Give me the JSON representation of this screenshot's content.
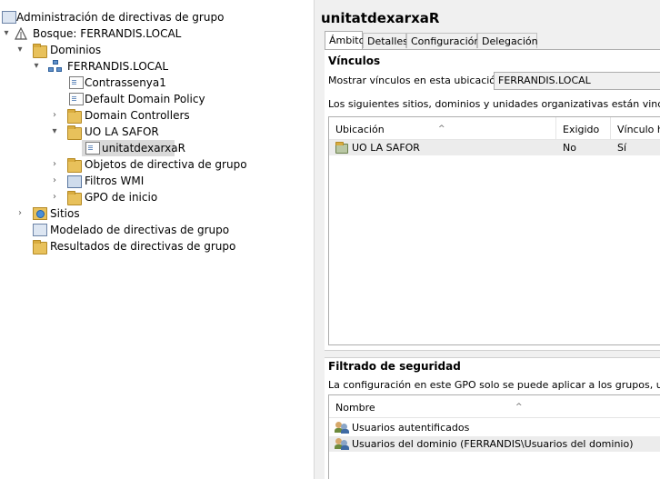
{
  "tree": {
    "root": "Administración de directivas de grupo",
    "forest": "Bosque: FERRANDIS.LOCAL",
    "domains": "Dominios",
    "domain": "FERRANDIS.LOCAL",
    "contrassenya": "Contrassenya1",
    "default_policy": "Default Domain Policy",
    "domain_controllers": "Domain Controllers",
    "ou": "UO LA SAFOR",
    "ou_gpo": "unitatdexarxaR",
    "gpo_objects": "Objetos de directiva de grupo",
    "wmi": "Filtros WMI",
    "starter": "GPO de inicio",
    "sites": "Sitios",
    "modeling": "Modelado de directivas de grupo",
    "results": "Resultados de directivas de grupo"
  },
  "detail": {
    "title": "unitatdexarxaR",
    "tabs": [
      "Ámbito",
      "Detalles",
      "Configuración",
      "Delegación"
    ],
    "links_section": "Vínculos",
    "show_links_label": "Mostrar vínculos en esta ubicación:",
    "show_links_value": "FERRANDIS.LOCAL",
    "links_description": "Los siguientes sitios, dominios y unidades organizativas están vinculados a este GPO:",
    "links_columns": [
      "Ubicación",
      "Exigido",
      "Vínculo habilitado"
    ],
    "links_rows": [
      {
        "location": "UO LA SAFOR",
        "enforced": "No",
        "enabled": "Sí"
      }
    ],
    "security_section": "Filtrado de seguridad",
    "security_description": "La configuración en este GPO solo se puede aplicar a los grupos, usuarios y equipos siguientes:",
    "security_column": "Nombre",
    "security_rows": [
      "Usuarios autentificados",
      "Usuarios del dominio (FERRANDIS\\Usuarios del dominio)"
    ]
  }
}
